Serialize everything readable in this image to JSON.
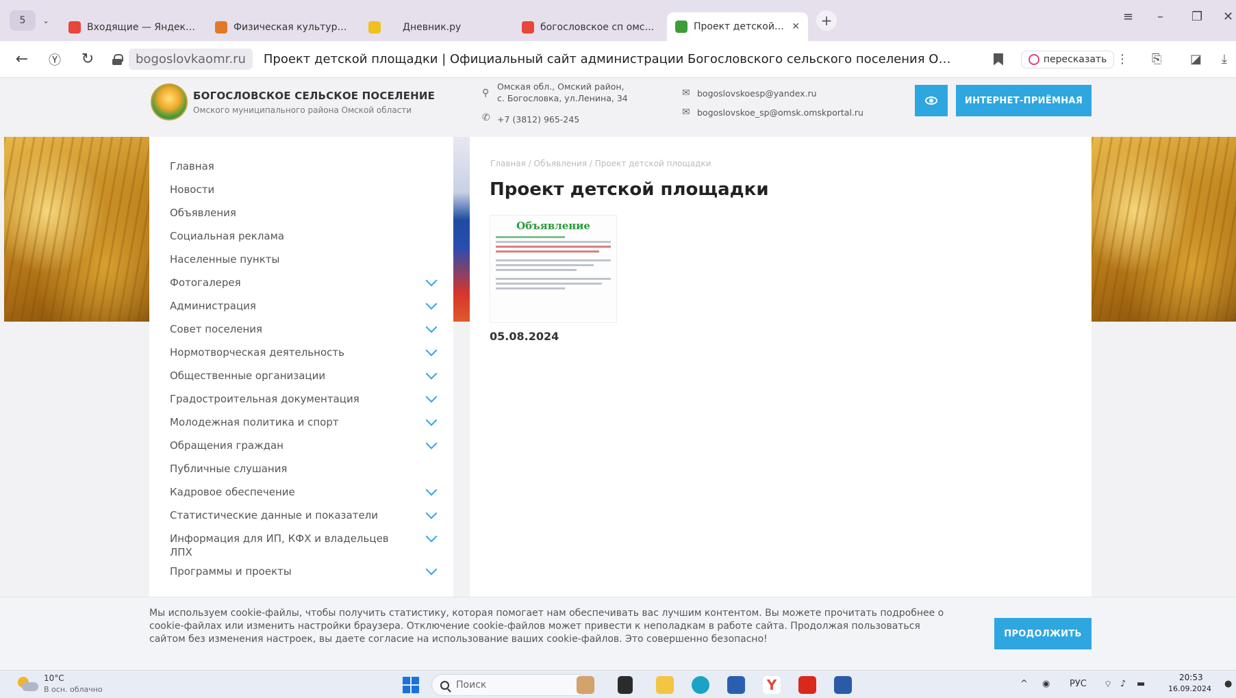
{
  "browser": {
    "tab_counter": "5",
    "tabs": [
      {
        "label": "Входящие — Яндекс Поч",
        "icon": "mail-icon",
        "color": "#e8453c"
      },
      {
        "label": "Физическая культур... · Е",
        "icon": "sport-site-icon",
        "color": "#e07a2a"
      },
      {
        "label": "",
        "icon": "diary-owl-icon",
        "color": "#f0c020"
      },
      {
        "label": "Дневник.ру",
        "icon": "",
        "color": ""
      },
      {
        "label": "богословское сп омский",
        "icon": "yandex-search-icon",
        "color": "#e8453c"
      },
      {
        "label": "Проект детской площ",
        "icon": "site-logo-icon",
        "color": "#3d9c3a"
      }
    ],
    "domain": "bogoslovkaomr.ru",
    "page_title": "Проект детской площадки | Официальный сайт администрации Богословского сельского поселения Омской...",
    "retell_label": "пересказать"
  },
  "site": {
    "org_name": "БОГОСЛОВСКОЕ СЕЛЬСКОЕ ПОСЕЛЕНИЕ",
    "org_subtitle": "Омского муниципального района Омской области",
    "address_line1": "Омская обл., Омский район,",
    "address_line2": "с. Богословка, ул.Ленина, 34",
    "phone": "+7 (3812) 965-245",
    "email1": "bogoslovskoesp@yandex.ru",
    "email2": "bogoslovskoe_sp@omsk.omskportal.ru",
    "reception_label": "ИНТЕРНЕТ-ПРИЁМНАЯ",
    "accent_color": "#2ea6e0"
  },
  "sidebar": {
    "items": [
      {
        "label": "Главная",
        "expandable": false
      },
      {
        "label": "Новости",
        "expandable": false
      },
      {
        "label": "Объявления",
        "expandable": false
      },
      {
        "label": "Социальная реклама",
        "expandable": false
      },
      {
        "label": "Населенные пункты",
        "expandable": false
      },
      {
        "label": "Фотогалерея",
        "expandable": true
      },
      {
        "label": "Администрация",
        "expandable": true
      },
      {
        "label": "Совет поселения",
        "expandable": true
      },
      {
        "label": "Нормотворческая деятельность",
        "expandable": true
      },
      {
        "label": "Общественные организации",
        "expandable": true
      },
      {
        "label": "Градостроительная документация",
        "expandable": true
      },
      {
        "label": "Молодежная политика и спорт",
        "expandable": true
      },
      {
        "label": "Обращения граждан",
        "expandable": true
      },
      {
        "label": "Публичные слушания",
        "expandable": false
      },
      {
        "label": "Кадровое обеспечение",
        "expandable": true
      },
      {
        "label": "Статистические данные и показатели",
        "expandable": true
      },
      {
        "label": "Информация для ИП, КФХ и владельцев ЛПХ",
        "expandable": true
      },
      {
        "label": "Программы и проекты",
        "expandable": true
      }
    ]
  },
  "main": {
    "breadcrumb": "Главная / Объявления / Проект детской площадки",
    "heading": "Проект детской площадки",
    "thumbnail_title": "Объявление",
    "date": "05.08.2024"
  },
  "cookie": {
    "text": "Мы используем cookie-файлы, чтобы получить статистику, которая помогает нам обеспечивать вас лучшим контентом. Вы можете прочитать подробнее о cookie-файлах или изменить настройки браузера. Отключение cookie-файлов может привести к неполадкам в работе сайта. Продолжая пользоваться сайтом без изменения настроек, вы даете согласие на использование ваших cookie-файлов. Это совершенно безопасно!",
    "button_label": "ПРОДОЛЖИТЬ"
  },
  "taskbar": {
    "temperature": "10°C",
    "weather": "В осн. облачно",
    "search_placeholder": "Поиск",
    "lang": "РУС",
    "time": "20:53",
    "date": "16.09.2024"
  }
}
